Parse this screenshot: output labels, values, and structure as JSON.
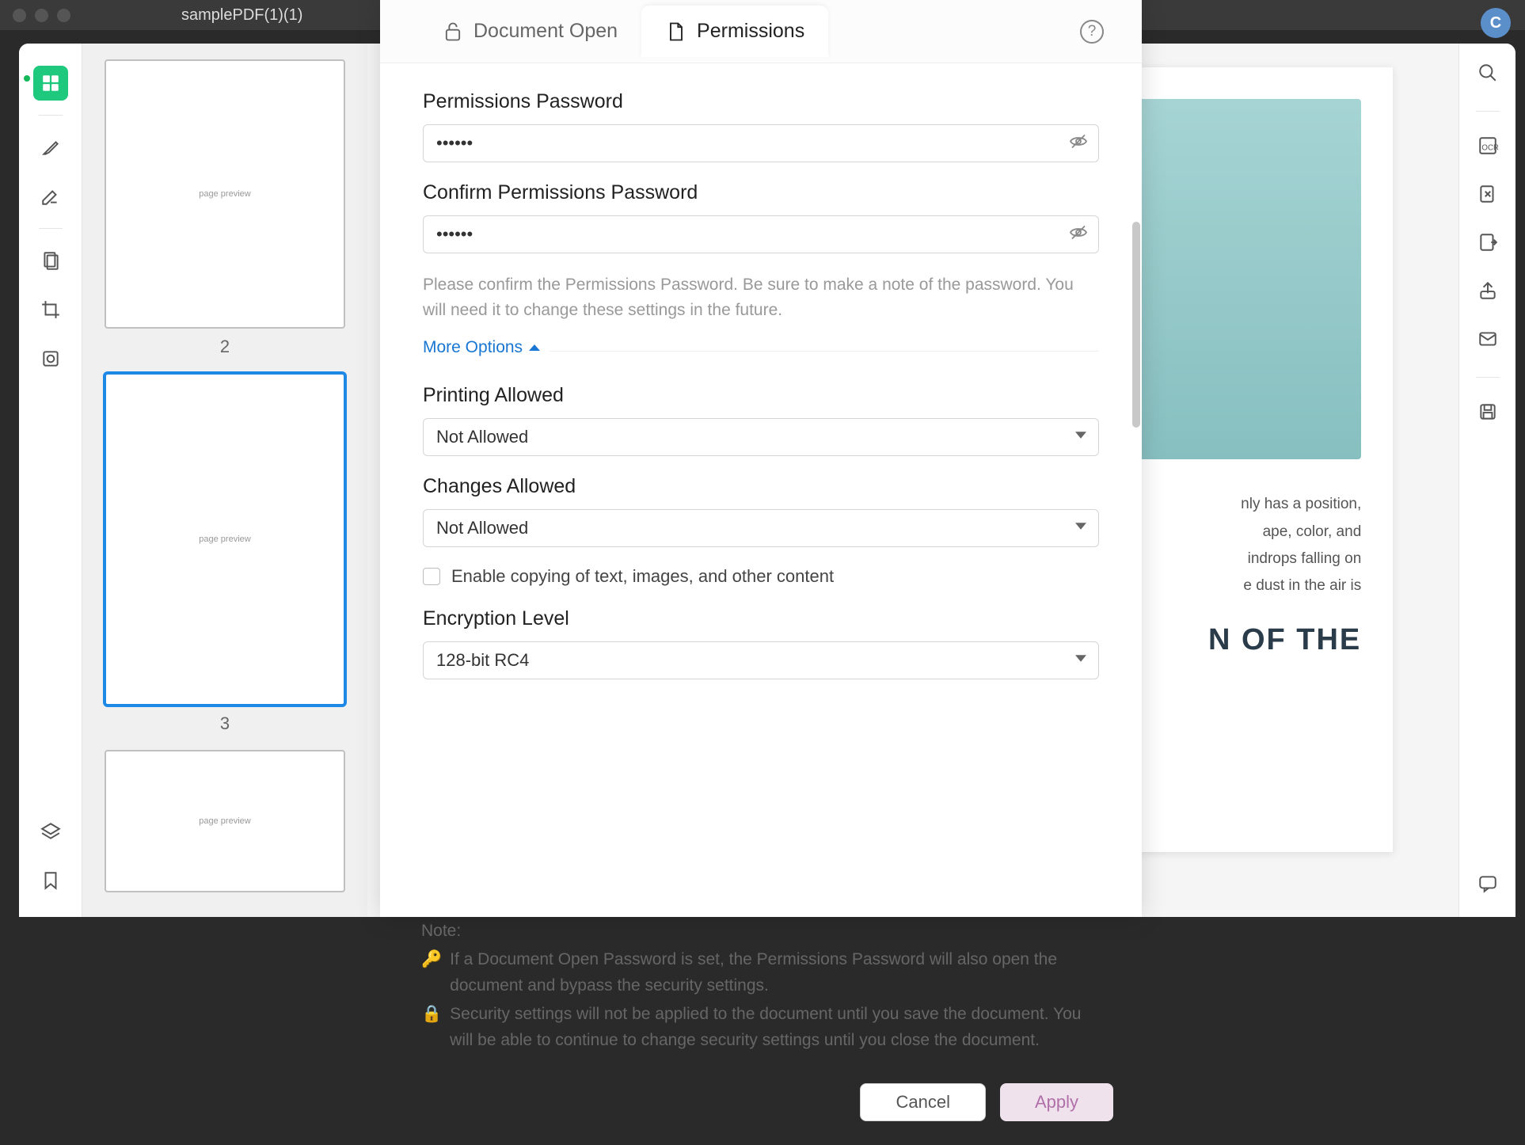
{
  "window": {
    "title": "samplePDF(1)(1)"
  },
  "avatar": {
    "initial": "C"
  },
  "thumbnails": {
    "pages": [
      {
        "num": "2",
        "selected": false
      },
      {
        "num": "3",
        "selected": true
      }
    ]
  },
  "document": {
    "heading_fragment": "N OF THE",
    "body_fragment": "nly has a position,\nape, color, and\nindrops falling on\ne dust in the air is"
  },
  "modal": {
    "tabs": {
      "doc_open": "Document Open",
      "permissions": "Permissions"
    },
    "permissions_pw_label": "Permissions Password",
    "confirm_pw_label": "Confirm Permissions Password",
    "pw_value": "••••••",
    "confirm_value": "••••••",
    "confirm_help": "Please confirm the Permissions Password. Be sure to make a note of the password. You will need it to change these settings in the future.",
    "more_options": "More Options",
    "printing_label": "Printing Allowed",
    "printing_value": "Not Allowed",
    "changes_label": "Changes Allowed",
    "changes_value": "Not Allowed",
    "copy_checkbox": "Enable copying of text, images, and other content",
    "encryption_label": "Encryption Level",
    "encryption_value": "128-bit RC4",
    "note_title": "Note:",
    "note_key": "If a Document Open Password is set, the Permissions Password will also open the document and bypass the security settings.",
    "note_lock": "Security settings will not be applied to the document until you save the document. You will be able to continue to change security settings until you close the document.",
    "cancel": "Cancel",
    "apply": "Apply"
  },
  "colors": {
    "accent_green": "#1ec97e",
    "link_blue": "#1976d2",
    "apply_fill": "#efe2ed",
    "apply_text": "#b06fa8"
  }
}
